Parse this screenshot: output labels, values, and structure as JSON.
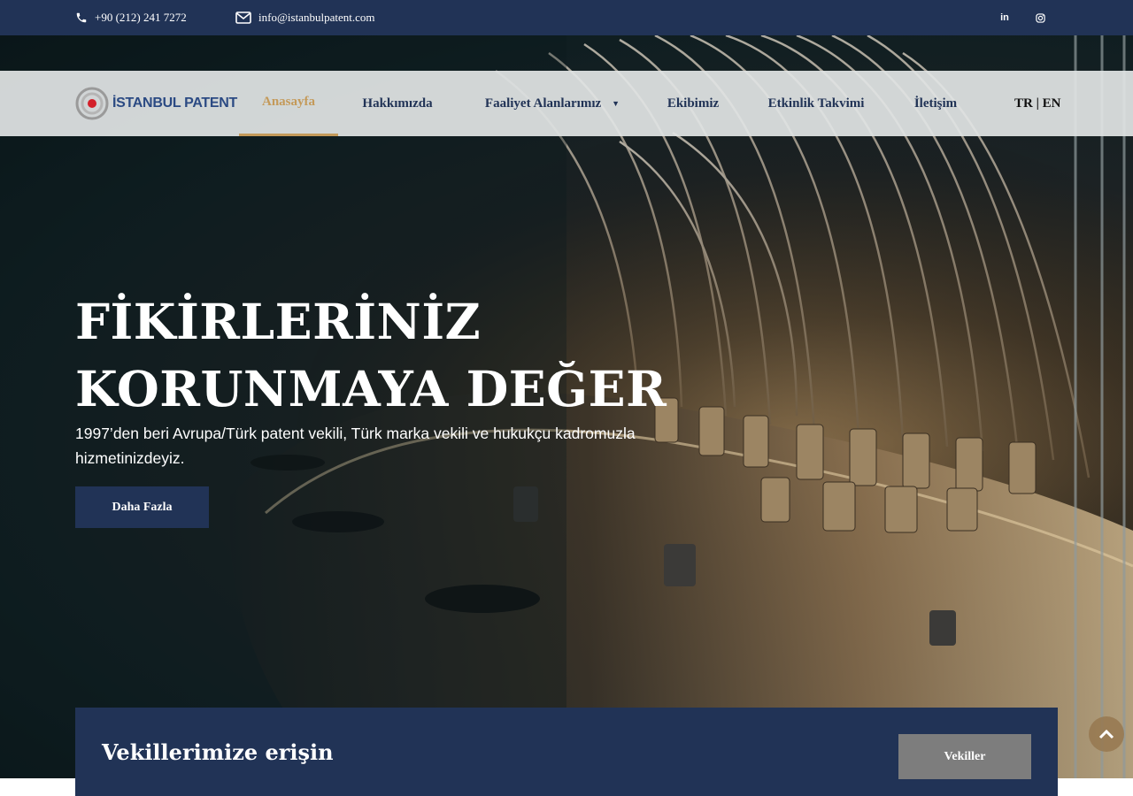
{
  "topbar": {
    "phone": "+90 (212) 241 7272",
    "phone_icon": "phone-icon",
    "email": "info@istanbulpatent.com",
    "email_icon": "envelope-icon",
    "social": [
      {
        "name": "linkedin-icon",
        "glyph": "in"
      },
      {
        "name": "instagram-icon",
        "glyph": "◎"
      }
    ]
  },
  "brand": {
    "logo_text": "İSTANBUL PATENT",
    "accent_color": "#c49a5a",
    "primary_color": "#213356"
  },
  "nav": {
    "items": [
      {
        "label": "Anasayfa",
        "active": true
      },
      {
        "label": "Hakkımızda"
      },
      {
        "label": "Faaliyet Alanlarımız",
        "dropdown": true
      },
      {
        "label": "Ekibimiz"
      },
      {
        "label": "Etkinlik Takvimi"
      },
      {
        "label": "İletişim"
      }
    ],
    "lang": "TR | EN"
  },
  "hero": {
    "title_line1": "FİKİRLERİNİZ",
    "title_line2": "KORUNMAYA DEĞER",
    "subtitle": "1997’den beri Avrupa/Türk patent vekili, Türk marka vekili ve hukukçu kadromuzla hizmetinizdeyiz.",
    "button": "Daha Fazla"
  },
  "access": {
    "title": "Vekillerimize erişin",
    "button": "Vekiller"
  },
  "scroll_top_icon": "chevron-up-icon"
}
